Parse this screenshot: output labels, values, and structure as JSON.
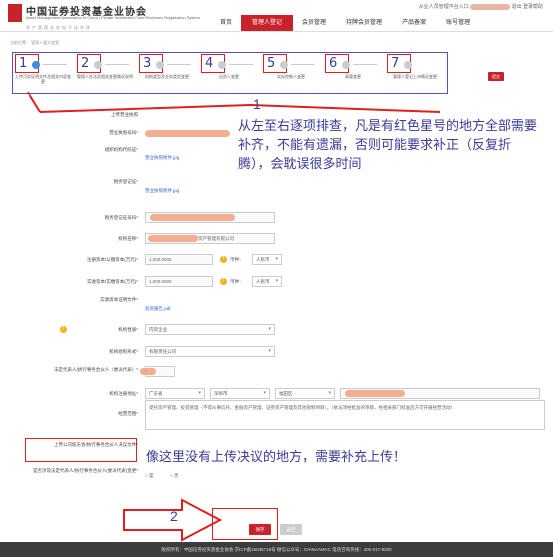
{
  "header": {
    "org_cn": "中国证券投资基金业协会",
    "org_en": "Asset Management Association of China | Private Investment Fund Electronic Registration System",
    "org_sub": "资产管理业务电子化系统",
    "top_links": "从业人员管理平台入口",
    "logout": "退出",
    "help": "登录帮助"
  },
  "nav": [
    "首页",
    "管理人登记",
    "会员管理",
    "持牌会员管理",
    "产品备案",
    "账号管理"
  ],
  "breadcrumb": "当前位置： 管理人重大变更",
  "steps": [
    {
      "num": "1",
      "label": "上传可实证明文件及相关内容变更",
      "done": true
    },
    {
      "num": "2",
      "label": "管理人办法及相关变更情况说明",
      "done": false
    },
    {
      "num": "3",
      "label": "机构类型及业务类型变更",
      "done": false
    },
    {
      "num": "4",
      "label": "出资人变更",
      "done": false
    },
    {
      "num": "5",
      "label": "实际控制人变更",
      "done": false
    },
    {
      "num": "6",
      "label": "高管变更",
      "done": false
    },
    {
      "num": "7",
      "label": "管理人登记上市情况变更",
      "done": false
    }
  ],
  "save_top": "提交",
  "annot": {
    "one": "1",
    "two": "2",
    "note1": "从左至右逐项排查，凡是有红色星号的地方全部需要补齐，不能有遗漏，否则可能要求补正（反复折腾），会耽误很多时间",
    "note2": "像这里没有上传决议的地方，需要补充上传！"
  },
  "form": {
    "upload_notice": "上传营业执照",
    "license_link": "营业执照附件.jpg",
    "credit_code_label": "营业执照号码*",
    "org_code_label": "组织机构代码证*",
    "org_code_link": "营业执照附件.jpg",
    "tax_label": "税务登记证*",
    "tax_link": "营业执照附件.jpg",
    "tax_no_label": "税务登记证号码*",
    "name_label": "机构名称*",
    "name_value": "资产管理有限公司",
    "reg_capital_label": "注册资本/认缴资本(万元)*",
    "reg_capital_value": "1,000.0000",
    "paid_capital_label": "实收资本/实缴资本(万元)*",
    "paid_capital_value": "1,000.0000",
    "currency_label": "币种：",
    "currency_value": "人民币",
    "paid_proof_label": "实收资本证明文件*",
    "paid_proof_link": "验资报告.pdf",
    "org_type_label": "机构性质*",
    "org_type_value": "内资企业",
    "org_form_label": "机构组织形式*",
    "org_form_value": "有限责任公司",
    "rep_label": "法定代表人/执行事务合伙人（委派代表）*",
    "address_label": "机构注册地址*",
    "province": "广东省",
    "city": "深圳市",
    "district": "福田区",
    "scope_label": "经营范围*",
    "scope_text": "受托资产管理、投资管理（不得从事信托、金融资产管理、证券资产管理及其他限制项目）。（依法须经批准的项目，经相关部门批准后方可开展经营活动）",
    "resolution_label": "上传公司股东会/执行事务合伙人决议文件*",
    "change_rep_label": "是否涉及法定代表人/执行事务合伙人(委派代表)变更*",
    "radio_yes": "是",
    "radio_no": "否"
  },
  "buttons": {
    "save": "保存",
    "back": "返回"
  },
  "footer": "版权所有：中国证券投资基金业协会    京ICP备16045718号    微信公众号：CHINAAMAC    电话咨询热线：400-017-8200"
}
